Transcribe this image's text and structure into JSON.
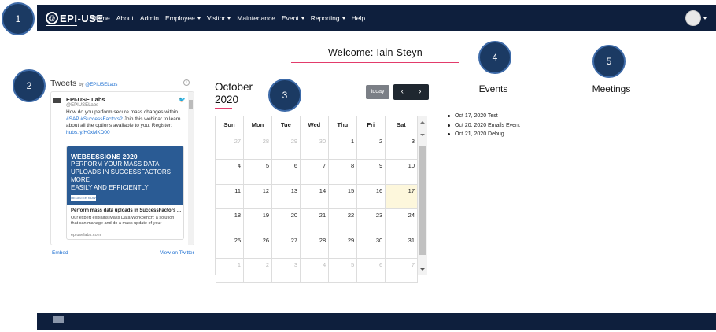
{
  "navbar": {
    "brand": "EPI-USE",
    "items": [
      {
        "label": "Home",
        "dropdown": false
      },
      {
        "label": "About",
        "dropdown": false
      },
      {
        "label": "Admin",
        "dropdown": false
      },
      {
        "label": "Employee",
        "dropdown": true
      },
      {
        "label": "Visitor",
        "dropdown": true
      },
      {
        "label": "Maintenance",
        "dropdown": false
      },
      {
        "label": "Event",
        "dropdown": true
      },
      {
        "label": "Reporting",
        "dropdown": true
      },
      {
        "label": "Help",
        "dropdown": false
      }
    ]
  },
  "callouts": [
    "1",
    "2",
    "3",
    "4",
    "5"
  ],
  "welcome": "Welcome: Iain Steyn",
  "twitter": {
    "title": "Tweets",
    "by": "by",
    "by_handle": "@EPIUSELabs",
    "account_name": "EPI-USE Labs",
    "account_handle": "@EPIUSELabs",
    "tweet_text": "How do you perform secure mass changes within",
    "tweet_hashtags": "#SAP #SuccessFactors?",
    "tweet_text2": "Join this webinar to learn about all the options available to you. Register:",
    "tweet_link": "hubs.ly/H0xMKD00",
    "card_heading": "WEBSESSIONS 2020",
    "card_line1": "PERFORM YOUR MASS DATA",
    "card_line2": "UPLOADS IN SUCCESSFACTORS MORE",
    "card_line3": "EASILY AND EFFICIENTLY",
    "card_button": "REGISTER NOW",
    "card_title": "Perform mass data uploads in SuccessFactors ...",
    "card_desc": "Our expert explains Mass Data Workbench; a solution that can manage and do a mass update of your",
    "card_domain": "epiuselabs.com",
    "embed": "Embed",
    "view_on_twitter": "View on Twitter"
  },
  "calendar": {
    "title_line1": "October",
    "title_line2": "2020",
    "today_label": "today",
    "prev_icon": "‹",
    "next_icon": "›",
    "weekdays": [
      "Sun",
      "Mon",
      "Tue",
      "Wed",
      "Thu",
      "Fri",
      "Sat"
    ],
    "weeks": [
      [
        "27",
        "28",
        "29",
        "30",
        "1",
        "2",
        "3"
      ],
      [
        "4",
        "5",
        "6",
        "7",
        "8",
        "9",
        "10"
      ],
      [
        "11",
        "12",
        "13",
        "14",
        "15",
        "16",
        "17"
      ],
      [
        "18",
        "19",
        "20",
        "21",
        "22",
        "23",
        "24"
      ],
      [
        "25",
        "26",
        "27",
        "28",
        "29",
        "30",
        "31"
      ],
      [
        "1",
        "2",
        "3",
        "4",
        "5",
        "6",
        "7"
      ]
    ],
    "today_date": "17"
  },
  "events": {
    "title": "Events",
    "items": [
      "Oct 17, 2020 Test",
      "Oct 20, 2020 Emails Event",
      "Oct 21, 2020 Debug"
    ]
  },
  "meetings": {
    "title": "Meetings"
  },
  "colors": {
    "navbar": "#0e1f3d",
    "accent": "#e23b6b",
    "link": "#1d6fd1",
    "today_highlight": "#fdf7dc"
  }
}
